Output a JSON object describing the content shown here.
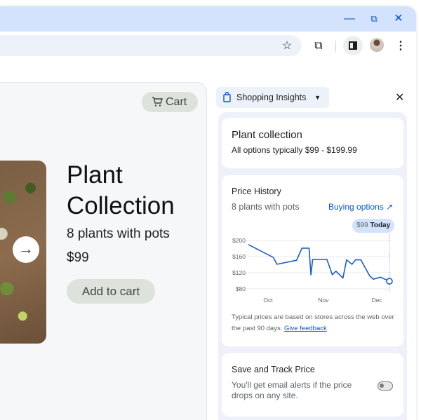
{
  "window": {
    "minimize_icon": "minimize-icon",
    "restore_icon": "restore-icon",
    "close_icon": "close-icon"
  },
  "toolbar": {
    "icons": [
      "star-icon",
      "extensions-icon",
      "side-panel-icon",
      "avatar",
      "more-icon"
    ]
  },
  "product": {
    "cart_label": "Cart",
    "title_line1": "Plant",
    "title_line2": "Collection",
    "subtitle": "8 plants with pots",
    "price": "$99",
    "add_to_cart": "Add to cart"
  },
  "side_panel": {
    "selector_label": "Shopping Insights",
    "summary": {
      "title": "Plant collection",
      "range": "All options typically $99 - $199.99"
    },
    "history": {
      "title": "Price History",
      "subtitle": "8 plants with pots",
      "buying_options": "Buying options",
      "tooltip_price": "$99",
      "tooltip_label": "Today",
      "note": "Typical prices are based on stores across the web over the past 90 days.",
      "feedback": "Give feedback"
    },
    "track": {
      "title": "Save and Track Price",
      "desc": "You'll get email alerts if the price drops on any site.",
      "toggle_on": false
    }
  },
  "chart_data": {
    "type": "line",
    "color": "#1a5dc8",
    "ylim": [
      80,
      200
    ],
    "yticks": [
      "$200",
      "$160",
      "$120",
      "$80"
    ],
    "ytick_values": [
      200,
      160,
      120,
      80
    ],
    "xticks": [
      "Oct",
      "Nov",
      "Dec"
    ],
    "xtick_dates": [
      "2000-10-01",
      "2000-11-01",
      "2000-12-01"
    ],
    "x": [
      "09-20",
      "10-04",
      "10-06",
      "10-17",
      "10-20",
      "10-24",
      "10-25",
      "10-26",
      "11-03",
      "11-06",
      "11-08",
      "11-12",
      "11-14",
      "11-17",
      "11-19",
      "11-22",
      "11-25",
      "11-27",
      "11-29",
      "12-03",
      "12-08"
    ],
    "values": [
      190,
      158,
      141,
      151,
      181,
      181,
      115,
      153,
      153,
      115,
      124,
      107,
      152,
      141,
      152,
      152,
      128,
      112,
      104,
      109,
      99
    ],
    "grid": true
  }
}
